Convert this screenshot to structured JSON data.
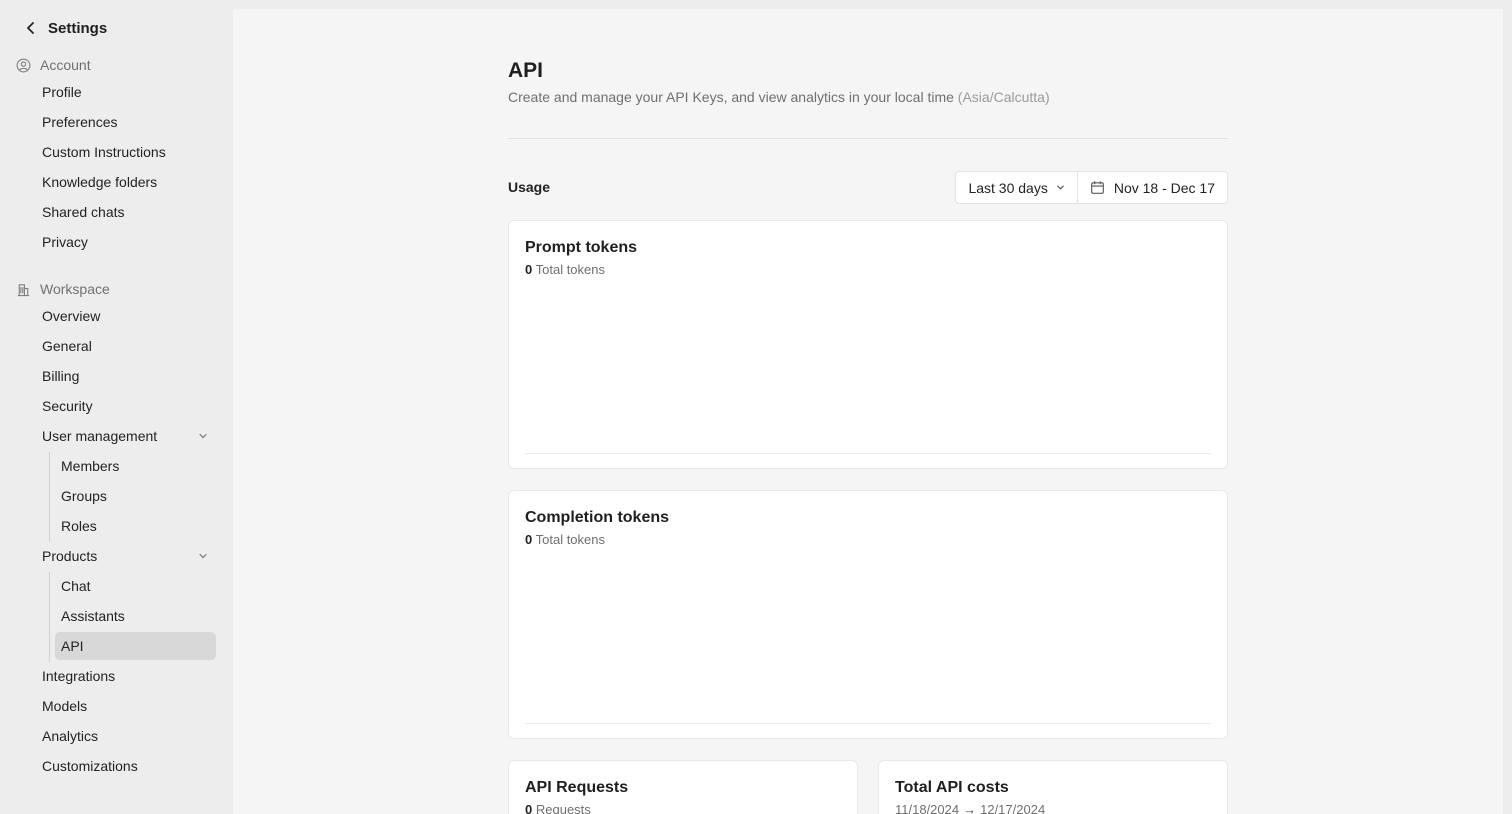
{
  "sidebar": {
    "back_title": "Settings",
    "account": {
      "heading": "Account",
      "items": [
        "Profile",
        "Preferences",
        "Custom Instructions",
        "Knowledge folders",
        "Shared chats",
        "Privacy"
      ]
    },
    "workspace": {
      "heading": "Workspace",
      "items": [
        "Overview",
        "General",
        "Billing",
        "Security"
      ],
      "user_management": {
        "label": "User management",
        "children": [
          "Members",
          "Groups",
          "Roles"
        ]
      },
      "products": {
        "label": "Products",
        "children": [
          "Chat",
          "Assistants",
          "API"
        ],
        "active": "API"
      },
      "bottom_items": [
        "Integrations",
        "Models",
        "Analytics",
        "Customizations"
      ]
    }
  },
  "main": {
    "title": "API",
    "subtitle": "Create and manage your API Keys, and view analytics in your local time",
    "timezone": "(Asia/Calcutta)",
    "usage_label": "Usage",
    "range_select": "Last 30 days",
    "date_range": "Nov 18 - Dec 17",
    "cards": {
      "prompt": {
        "title": "Prompt tokens",
        "value": "0",
        "unit": "Total tokens"
      },
      "completion": {
        "title": "Completion tokens",
        "value": "0",
        "unit": "Total tokens"
      },
      "requests": {
        "title": "API Requests",
        "value": "0",
        "unit": "Requests"
      },
      "costs": {
        "title": "Total API costs",
        "from": "11/18/2024",
        "to": "12/17/2024"
      }
    }
  },
  "icons": {
    "back": "chevron-left-icon",
    "account": "user-circle-icon",
    "workspace": "building-icon",
    "expand": "chevron-down-icon",
    "calendar": "calendar-icon"
  }
}
